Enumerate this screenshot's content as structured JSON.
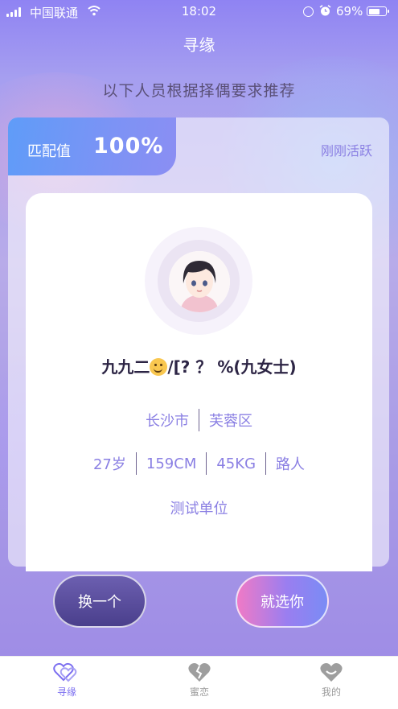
{
  "status_bar": {
    "carrier": "中国联通",
    "time": "18:02",
    "battery_percent": "69%",
    "battery_level": 0.69
  },
  "nav": {
    "title": "寻缘"
  },
  "subtitle": "以下人员根据择偶要求推荐",
  "match": {
    "label": "匹配值",
    "value": "100%",
    "activity": "刚刚活跃"
  },
  "profile": {
    "name_prefix": "九九二",
    "emoji": "slightly-smiling-face-emoji",
    "name_suffix": "/[? ？ %(九女士)",
    "city": "长沙市",
    "district": "芙蓉区",
    "age": "27岁",
    "height": "159CM",
    "weight": "45KG",
    "tag": "路人",
    "workplace": "测试单位"
  },
  "actions": {
    "change_label": "换一个",
    "choose_label": "就选你"
  },
  "tabs": [
    {
      "label": "寻缘",
      "icon": "heart-outline-icon",
      "active": true
    },
    {
      "label": "蜜恋",
      "icon": "broken-heart-icon",
      "active": false
    },
    {
      "label": "我的",
      "icon": "heart-smile-icon",
      "active": false
    }
  ],
  "colors": {
    "accent": "#8a7fe3",
    "tab_active": "#7c6ff0",
    "match_tag": "#5f9cf8"
  }
}
